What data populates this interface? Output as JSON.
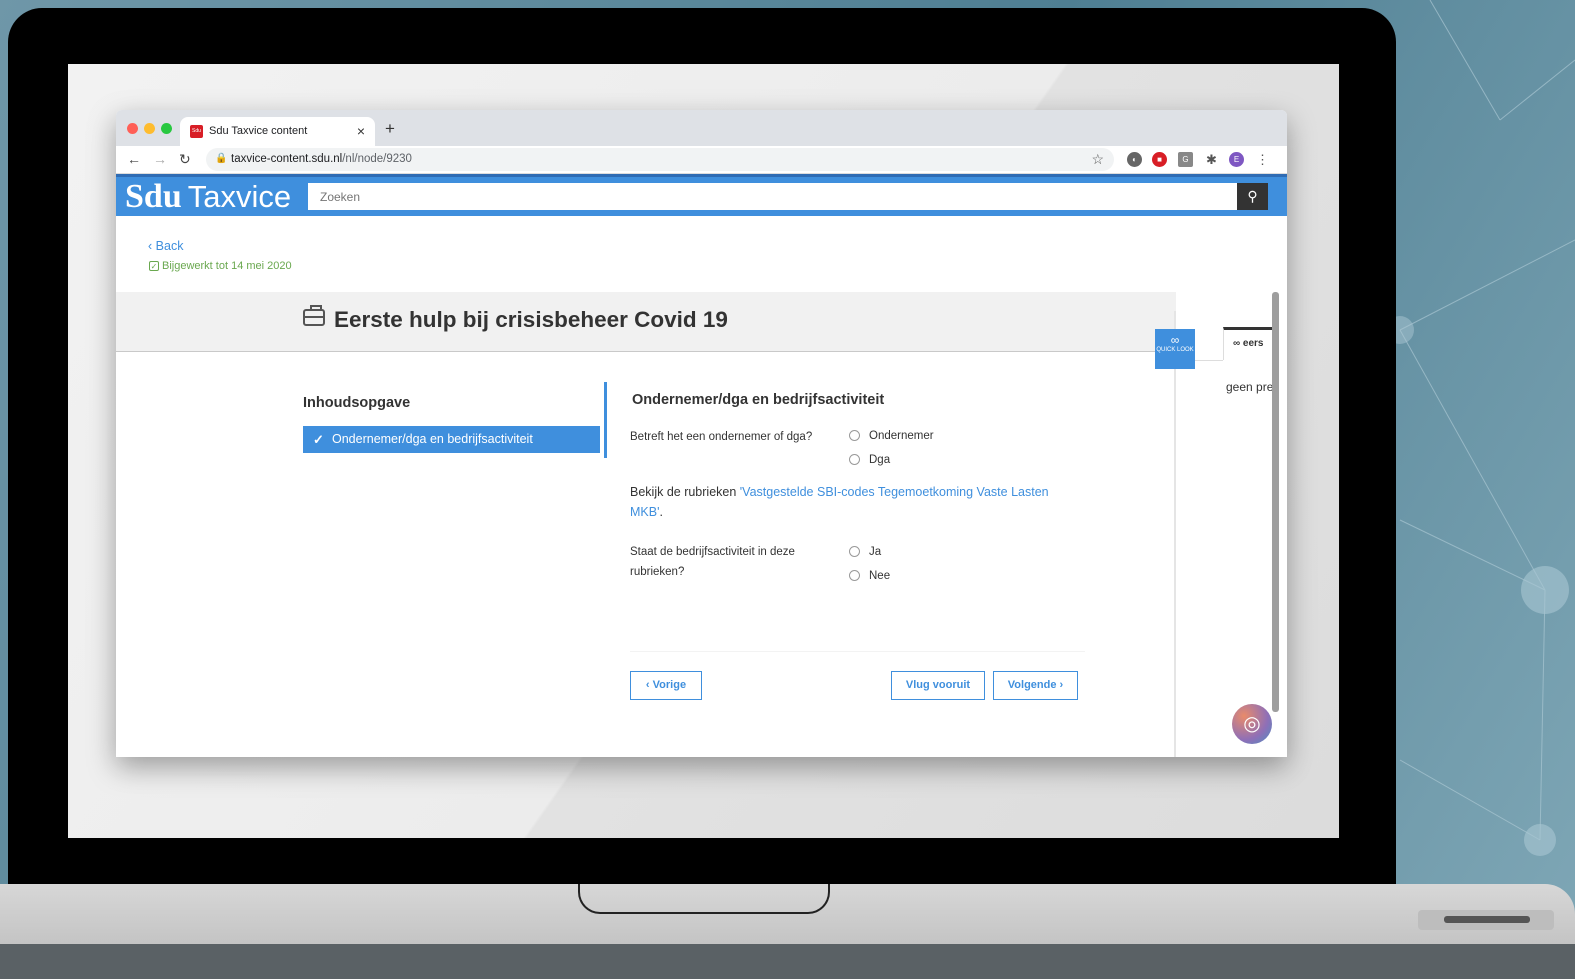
{
  "browser": {
    "tab_title": "Sdu Taxvice content",
    "tab_favicon": "Sdu",
    "url_host": "taxvice-content.sdu.nl",
    "url_path": "/nl/node/9230",
    "profile_initial": "E"
  },
  "header": {
    "logo_sdu": "Sdu",
    "logo_taxvice": "Taxvice",
    "search_placeholder": "Zoeken"
  },
  "page": {
    "back_label": "Back",
    "updated_label": "Bijgewerkt tot 14 mei 2020",
    "title": "Eerste hulp bij crisisbeheer Covid 19"
  },
  "toc": {
    "heading": "Inhoudsopgave",
    "items": [
      {
        "label": "Ondernemer/dga en bedrijfsactiviteit",
        "active": true
      }
    ]
  },
  "form": {
    "section_title": "Ondernemer/dga en bedrijfsactiviteit",
    "q1_label": "Betreft het een ondernemer of dga?",
    "q1_options": [
      "Ondernemer",
      "Dga"
    ],
    "info_prefix": "Bekijk de rubrieken ",
    "info_link": "'Vastgestelde SBI-codes Tegemoetkoming Vaste Lasten MKB'",
    "info_suffix": ".",
    "q2_label": "Staat de bedrijfsactiviteit in deze rubrieken?",
    "q2_options": [
      "Ja",
      "Nee"
    ],
    "prev_label": "Vorige",
    "fast_label": "Vlug vooruit",
    "next_label": "Volgende"
  },
  "side": {
    "quick_look_label": "QUICK LOOK",
    "tab_label": "eers",
    "text": "geen pre"
  },
  "colors": {
    "accent": "#3f8fdd",
    "updated_green": "#6aa84f"
  }
}
